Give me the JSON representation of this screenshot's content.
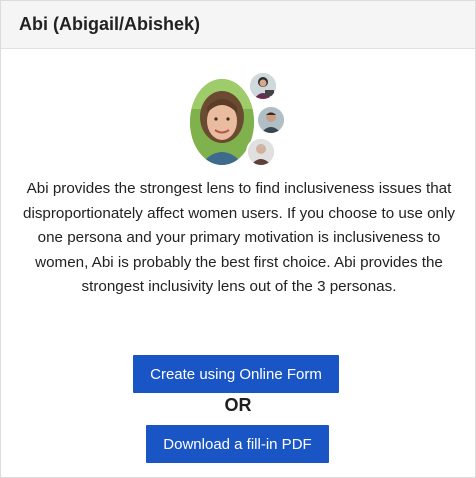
{
  "card": {
    "title": "Abi (Abigail/Abishek)"
  },
  "persona": {
    "main_avatar": "woman-portrait-avatar",
    "small_avatars": [
      "woman-at-computer-avatar",
      "man-portrait-avatar",
      "older-man-avatar"
    ],
    "description": "Abi provides the strongest lens to find inclusiveness issues that disproportionately affect women users. If you choose to use only one persona and your primary motivation is inclusiveness to women, Abi is probably the best first choice. Abi provides the strongest inclusivity lens out of the 3 personas."
  },
  "actions": {
    "online_form_label": "Create using Online Form",
    "or_label": "OR",
    "pdf_label": "Download a fill-in PDF"
  },
  "colors": {
    "button_bg": "#1a55c5",
    "header_bg": "#f5f5f5",
    "text": "#222222"
  }
}
